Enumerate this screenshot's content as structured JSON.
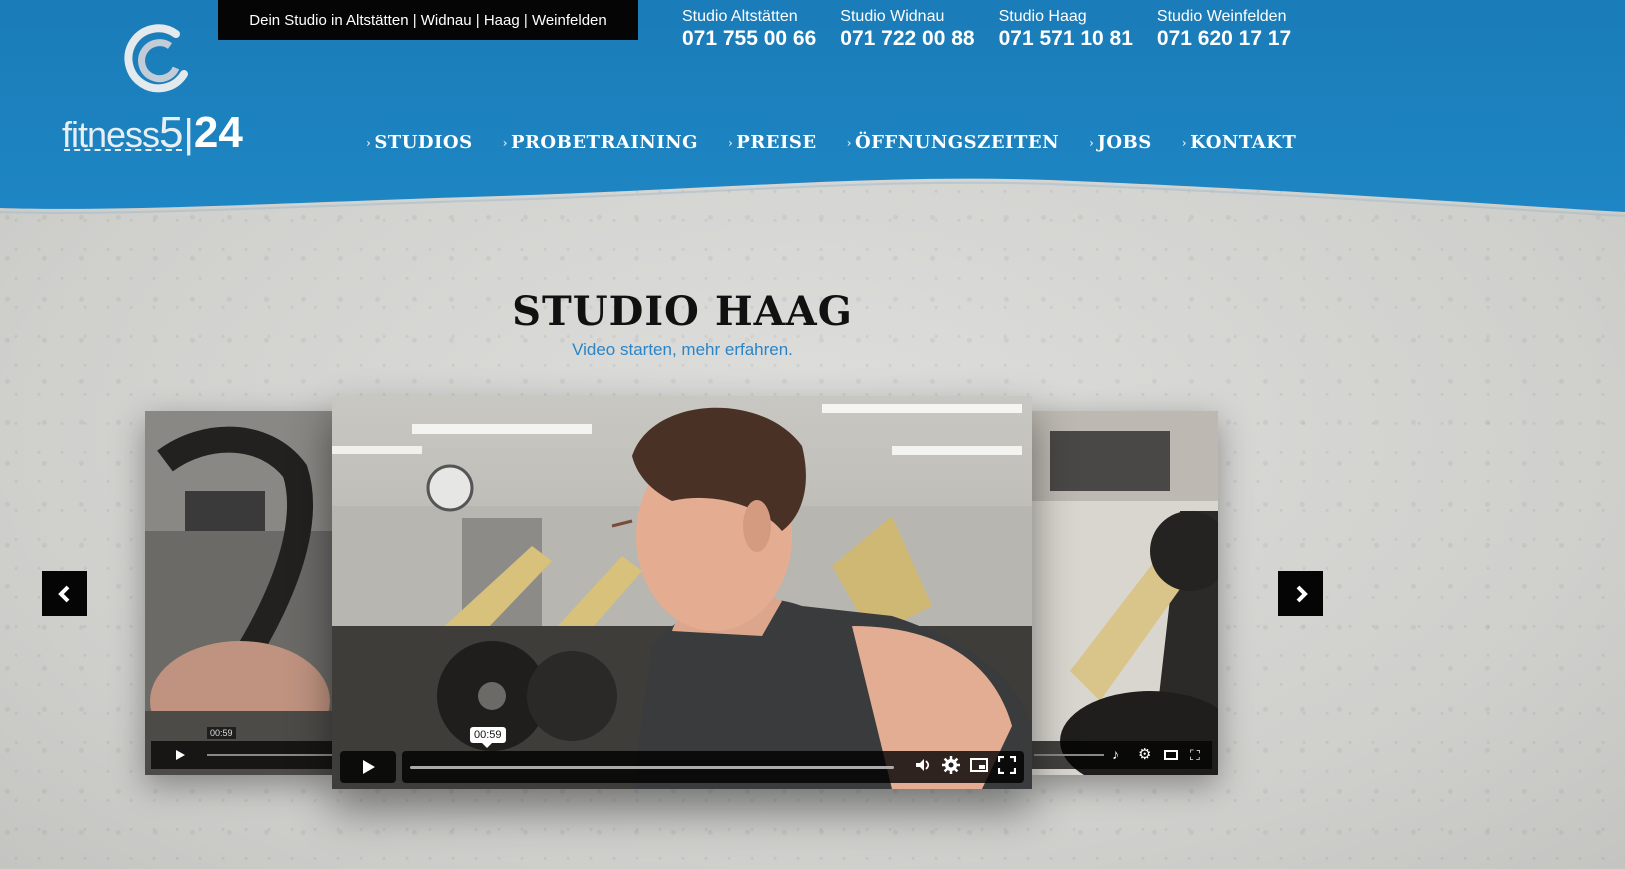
{
  "colors": {
    "header_blue": "#1a7cb8",
    "accent": "#2b84c6",
    "black": "#050505"
  },
  "topbar": {
    "text": "Dein Studio in Altstätten | Widnau | Haag | Weinfelden"
  },
  "logo": {
    "part1": "fitness",
    "part2": "5",
    "part3": "24"
  },
  "phones": [
    {
      "label": "Studio Altstätten",
      "number": "071 755 00 66"
    },
    {
      "label": "Studio Widnau",
      "number": "071 722 00 88"
    },
    {
      "label": "Studio Haag",
      "number": "071 571 10 81"
    },
    {
      "label": "Studio Weinfelden",
      "number": "071 620 17 17"
    }
  ],
  "nav": [
    {
      "label": "STUDIOS"
    },
    {
      "label": "PROBETRAINING"
    },
    {
      "label": "PREISE"
    },
    {
      "label": "ÖFFNUNGSZEITEN"
    },
    {
      "label": "JOBS"
    },
    {
      "label": "KONTAKT"
    }
  ],
  "page": {
    "title": "STUDIO HAAG",
    "subtitle": "Video starten, mehr erfahren."
  },
  "video": {
    "time_tooltip": "00:59",
    "side_time": "00:59"
  },
  "icons": {
    "logo": "fitness-logo-icon",
    "prev": "chevron-left-icon",
    "next": "chevron-right-icon",
    "play": "play-icon",
    "volume": "volume-icon",
    "settings": "gear-icon",
    "pip": "picture-in-picture-icon",
    "fullscreen": "fullscreen-icon"
  }
}
